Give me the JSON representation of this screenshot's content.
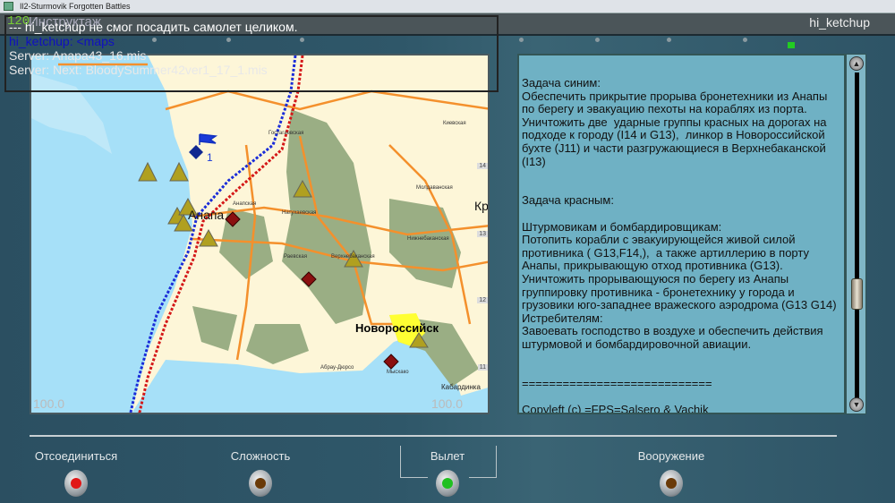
{
  "window": {
    "title": "Il2-Sturmovik Forgotten Battles"
  },
  "header": {
    "title": "Инструктаж",
    "user": "hi_ketchup",
    "fps": "120"
  },
  "chat": [
    {
      "text": "--- hi_ketchup не смог посадить самолет целиком.",
      "color": "#ffffff"
    },
    {
      "text": "hi_ketchup: <maps",
      "color": "#1010c0"
    },
    {
      "text": "Server:    Anapa43_16.mis",
      "color": "#e8e8e8"
    },
    {
      "text": "Server: Next: BloodySummer42ver1_17_1.mis",
      "color": "#e8e8e8"
    }
  ],
  "map": {
    "labels": {
      "gostagaevskaya": "Гостагаевская",
      "anapa": "Анапа",
      "anapskaya": "Анапская",
      "natukhaevskaya": "Натухаевская",
      "kr": "Кр",
      "kievskaya": "Киевская",
      "moldavanskaya": "Молдаванская",
      "nizhnebakanskaya": "Нижнебаканская",
      "raevskaya": "Раевская",
      "verkhnebakanskaya": "Верхнебаканская",
      "novorossiysk": "Новороссийск",
      "abrau": "Абрау-Дюрсо",
      "myskhako": "Мысхако",
      "kabardinka": "Кабардинка"
    },
    "grid": [
      "14",
      "13",
      "12",
      "11"
    ],
    "scale_left": "100.0",
    "scale_right": "100.0",
    "waypoint": "1",
    "colors": {
      "sea": "#a6e0f8",
      "land": "#fdf6d8",
      "forest": "#9aae84",
      "road": "#f4902c",
      "blue_front": "#1a2cd8",
      "red_front": "#d41818"
    }
  },
  "briefing": {
    "text": "Задача синим:\nОбеспечить прикрытие прорыва бронетехники из Анапы по берегу и эвакуацию пехоты на кораблях из порта.\nУничтожить две  ударные группы красных на дорогах на подходе к городу (I14 и G13),  линкор в Новороссийской бухте (J11) и части разгружающиеся в Верхнебаканской (I13)\n\n\nЗадача красным:\n\nШтурмовикам и бомбардировщикам:\nПотопить корабли с эвакуирующейся живой силой противника ( G13,F14,),  а также артиллерию в порту Анапы, прикрывающую отход противника (G13).\nУничтожить прорывающуюся по берегу из Анапы группировку противника - бронетехнику у города и грузовики юго-западнее вражеского аэродрома (G13 G14)\nИстребителям:\nЗавоевать господство в воздухе и обеспечить действия штурмовой и бомбардировочной авиации.\n\n\n============================\n\nCopyleft (c) =FPS=Salsero & Vachik"
  },
  "buttons": [
    {
      "label": "Отсоединиться",
      "lamp": "#e01818"
    },
    {
      "label": "Сложность",
      "lamp": "#6a3a08"
    },
    {
      "label": "Вылет",
      "lamp": "#20c020"
    },
    {
      "label": "Вооружение",
      "lamp": "#6a3a08"
    }
  ]
}
